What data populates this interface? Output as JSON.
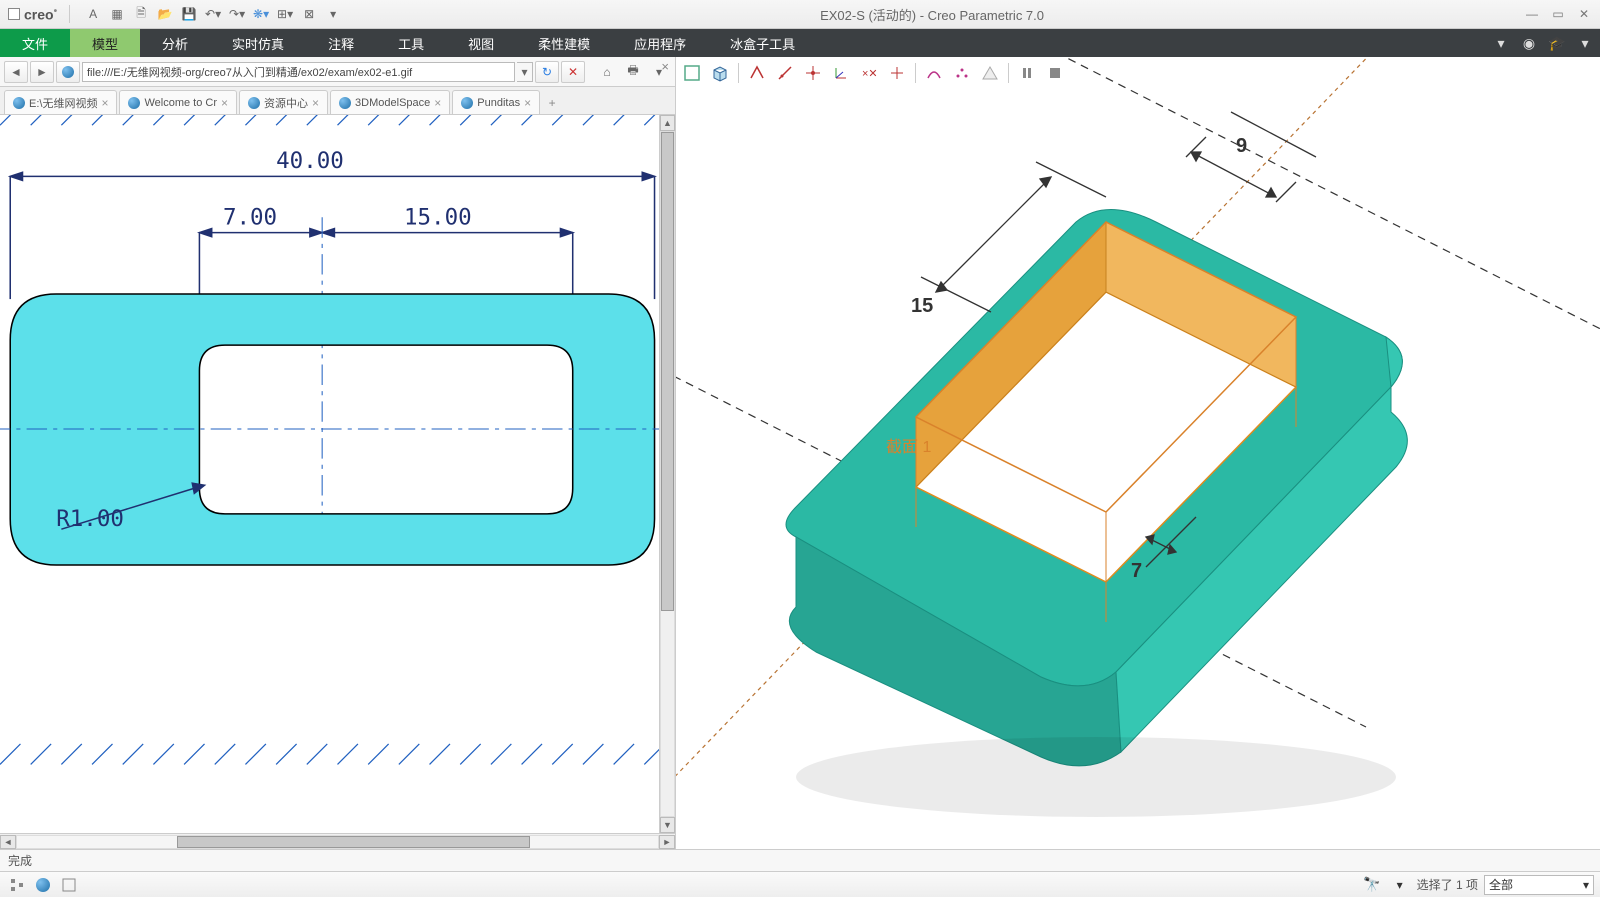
{
  "app": {
    "logo": "creo",
    "title": "EX02-S (活动的) - Creo Parametric 7.0"
  },
  "ribbon": {
    "file": "文件",
    "tabs": [
      "模型",
      "分析",
      "实时仿真",
      "注释",
      "工具",
      "视图",
      "柔性建模",
      "应用程序",
      "冰盒子工具"
    ],
    "active_index": 0
  },
  "browser": {
    "url": "file:///E:/无维网视频-org/creo7从入门到精通/ex02/exam/ex02-e1.gif",
    "tabs": [
      {
        "label": "E:\\无维网视频"
      },
      {
        "label": "Welcome to Cr"
      },
      {
        "label": "资源中心"
      },
      {
        "label": "3DModelSpace"
      },
      {
        "label": "Punditas"
      }
    ]
  },
  "drawing": {
    "dim_width": "40.00",
    "dim_a": "7.00",
    "dim_b": "15.00",
    "dim_r": "R1.00"
  },
  "model": {
    "dim1": "9",
    "dim2": "15",
    "dim3": "7",
    "section_label": "截面 1"
  },
  "status": {
    "text": "完成"
  },
  "selection": {
    "count_label": "选择了 1 项",
    "filter": "全部"
  }
}
